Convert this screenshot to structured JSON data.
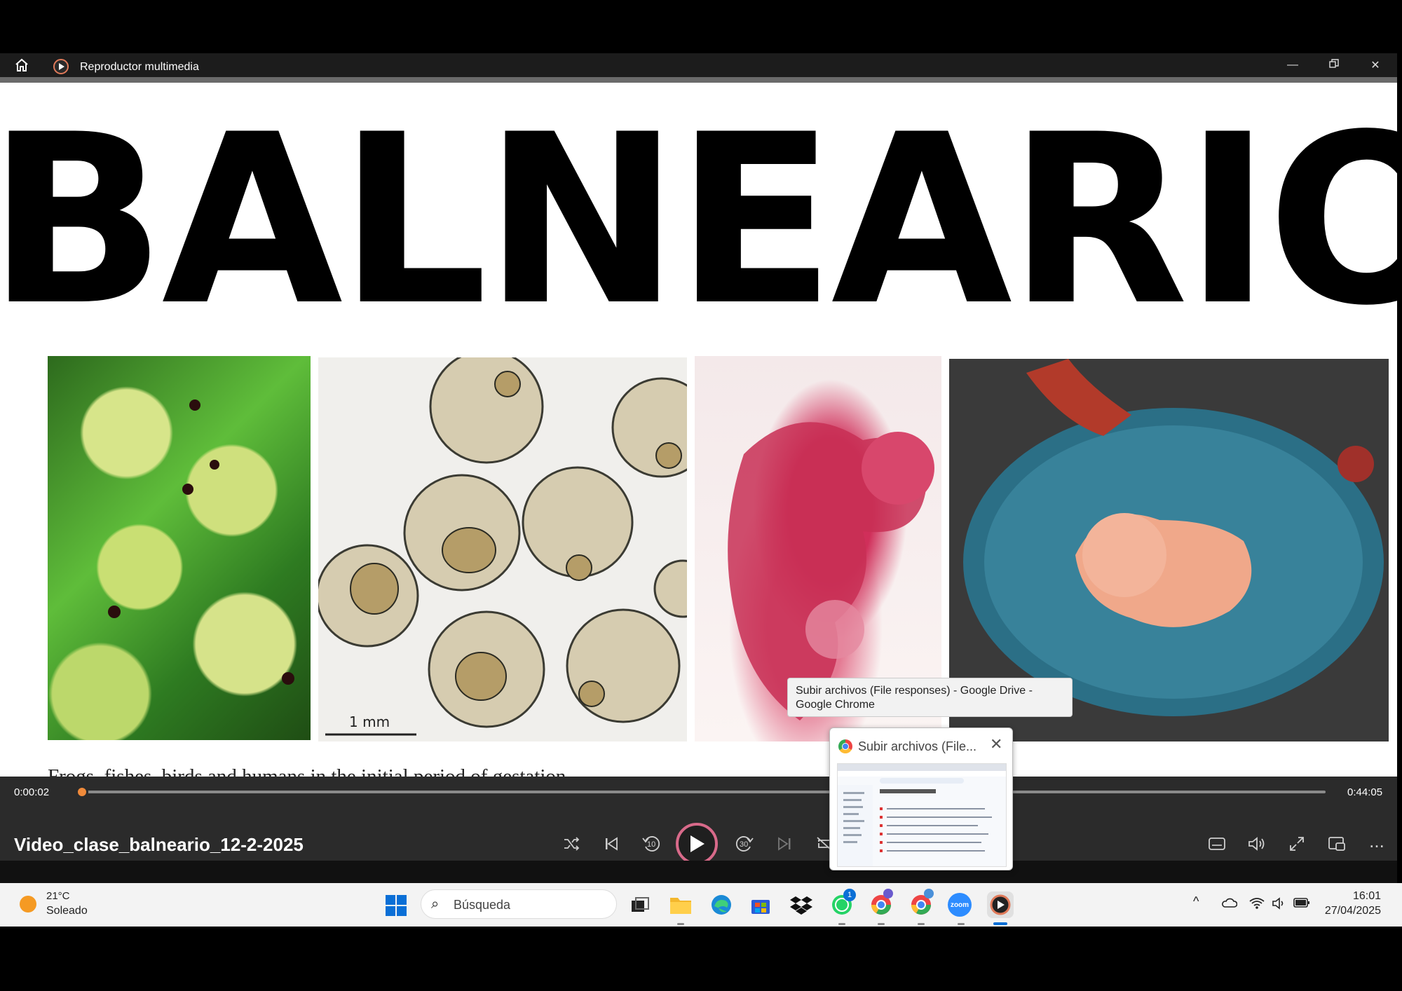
{
  "window": {
    "title": "Reproductor multimedia",
    "icons": [
      "home-icon",
      "media-player-icon",
      "minimize-icon",
      "restore-icon",
      "close-icon"
    ]
  },
  "slide": {
    "title": "BALNEARIOS",
    "scale_label": "1 mm",
    "caption": "Frogs, fishes, birds and humans in the initial period of gestation."
  },
  "player": {
    "current_time": "0:00:02",
    "total_time": "0:44:05",
    "progress_fraction": 0.0008,
    "video_title": "Video_clase_balneario_12-2-2025",
    "controls": [
      "shuffle-icon",
      "previous-icon",
      "rewind-10-icon",
      "play-icon",
      "forward-30-icon",
      "next-icon",
      "repeat-icon"
    ],
    "rewind_label": "10",
    "forward_label": "30",
    "right_controls": [
      "subtitles-icon",
      "volume-icon",
      "fullscreen-icon",
      "mini-player-icon",
      "more-options-icon"
    ],
    "more_label": "..."
  },
  "tooltip": {
    "text": "Subir archivos (File responses) - Google Drive - Google Chrome"
  },
  "thumbnail": {
    "title": "Subir archivos (File...",
    "close": "✕"
  },
  "taskbar": {
    "weather_temp": "21°C",
    "weather_desc": "Soleado",
    "search_placeholder": "Búsqueda",
    "whatsapp_badge": "1",
    "clock_time": "16:01",
    "clock_date": "27/04/2025",
    "zoom_label": "zoom",
    "tray_up": "^"
  },
  "colors": {
    "accent_orange": "#f08a3a",
    "play_ring": "#d86a8a",
    "player_bg": "#2b2b2b",
    "titlebar_bg": "#1c1c1c"
  }
}
